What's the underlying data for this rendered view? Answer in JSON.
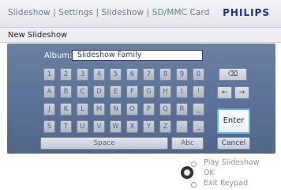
{
  "header": {
    "breadcrumb": "Slideshow | Settings | Slideshow | SD/MMC Card",
    "brand": "PHILIPS"
  },
  "subheader": {
    "title": "New Slideshow"
  },
  "form": {
    "album_label": "Album:",
    "album_value": "Slideshow Family"
  },
  "keyboard": {
    "rows": [
      [
        "1",
        "2",
        "3",
        "4",
        "5",
        "6",
        "7",
        "8",
        "9",
        "0"
      ],
      [
        "A",
        "B",
        "C",
        "D",
        "E",
        "F",
        "G",
        "H",
        "I",
        "!"
      ],
      [
        "J",
        "K",
        "L",
        "M",
        "N",
        "O",
        "P",
        "Q",
        "R",
        "_"
      ],
      [
        "S",
        "T",
        "U",
        "V",
        "W",
        "X",
        "Y",
        "Z",
        ".",
        "_"
      ]
    ],
    "backspace_symbol": "⌫",
    "left_arrow": "←",
    "right_arrow": "→",
    "enter_label": "Enter",
    "space_label": "Space",
    "abc_label": "Abc",
    "cancel_label": "Cancel"
  },
  "legend": {
    "play": "Play Slideshow",
    "ok": "OK",
    "exit": "Exit Keypad"
  }
}
